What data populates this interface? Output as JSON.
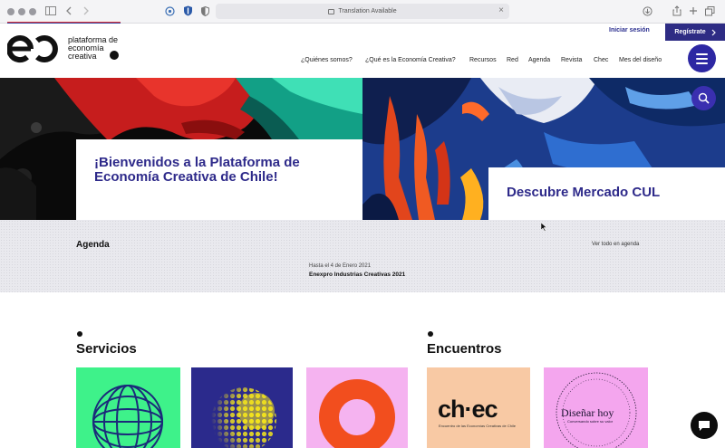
{
  "browser": {
    "url_text": "Translation Available",
    "icons": [
      "sidebar-icon",
      "back-icon",
      "forward-icon",
      "extension-icon",
      "shield-icon",
      "privacy-icon",
      "translate-icon",
      "download-icon",
      "share-icon",
      "new-tab-icon",
      "tabs-overview-icon"
    ]
  },
  "header": {
    "logo_text_line1": "plataforma de",
    "logo_text_line2": "economía",
    "logo_text_line3": "creativa",
    "login_label": "Iniciar sesión",
    "register_label": "Regístrate",
    "nav": [
      "¿Quiénes somos?",
      "¿Qué es la Economía Creativa?",
      "Recursos",
      "Red",
      "Agenda",
      "Revista",
      "Chec",
      "Mes del diseño"
    ]
  },
  "hero": {
    "left_title": "¡Bienvenidos a la Plataforma de Economía Creativa de Chile!",
    "right_title": "Descubre Mercado CUL"
  },
  "agenda": {
    "title": "Agenda",
    "view_all": "Ver todo en agenda",
    "event_date": "Hasta el 4 de Enero 2021",
    "event_title": "Enexpro Industrias Creativas 2021"
  },
  "sections": {
    "services_title": "Servicios",
    "meetings_title": "Encuentros",
    "chec_logo_text": "ch·ec",
    "chec_caption": "Encuentro de las Economías Creativas de Chile",
    "disenar_title": "Diseñar hoy",
    "disenar_caption": "Conversando sobre su valor",
    "disenar_ring": "MES DEL DISEÑO 2020 · MES DEL DISEÑO 2020 · MES DEL DISEÑO 2020 ·"
  },
  "colors": {
    "brand_purple": "#2e2a8a",
    "register_bg": "#2e2c84",
    "menu_circle": "#2d27a3",
    "tile_green": "#3ef28a",
    "tile_navy": "#2b2a8c",
    "tile_pink": "#f5b3f0",
    "tile_peach": "#f8c9a4",
    "tile_pink2": "#f4a6ee"
  }
}
